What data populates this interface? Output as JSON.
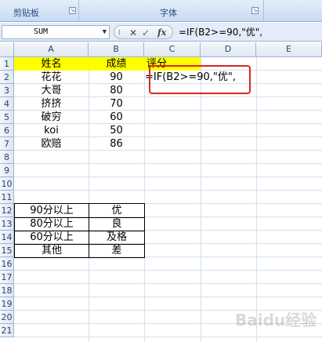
{
  "ribbon": {
    "groups": [
      {
        "label": "剪贴板"
      },
      {
        "label": "字体"
      }
    ]
  },
  "formula_bar": {
    "name_box": "SUM",
    "formula": "=IF(B2>=90,\"优\","
  },
  "columns": [
    "A",
    "B",
    "C",
    "D",
    "E"
  ],
  "rows": [
    "1",
    "2",
    "3",
    "4",
    "5",
    "6",
    "7",
    "8",
    "9",
    "10",
    "11",
    "12",
    "13",
    "14",
    "15",
    "16",
    "17",
    "18",
    "19",
    "20",
    "21"
  ],
  "sheet": {
    "header": {
      "name": "姓名",
      "score": "成绩",
      "grade": "评分"
    },
    "students": [
      {
        "name": "花花",
        "score": "90"
      },
      {
        "name": "大哥",
        "score": "80"
      },
      {
        "name": "挤挤",
        "score": "70"
      },
      {
        "name": "破穷",
        "score": "60"
      },
      {
        "name": "koi",
        "score": "50"
      },
      {
        "name": "欧赔",
        "score": "86"
      }
    ],
    "editing_cell": {
      "ref": "C2",
      "text": "=IF(B2>=90,\"优\","
    },
    "grade_table": [
      {
        "range": "90分以上",
        "grade": "优"
      },
      {
        "range": "80分以上",
        "grade": "良"
      },
      {
        "range": "60分以上",
        "grade": "及格"
      },
      {
        "range": "其他",
        "grade": "差"
      }
    ]
  },
  "watermark": "Baidu经验",
  "colors": {
    "highlight": "#ffff00",
    "annotation": "#d9261c",
    "header_bg": "#dfe7f2"
  }
}
